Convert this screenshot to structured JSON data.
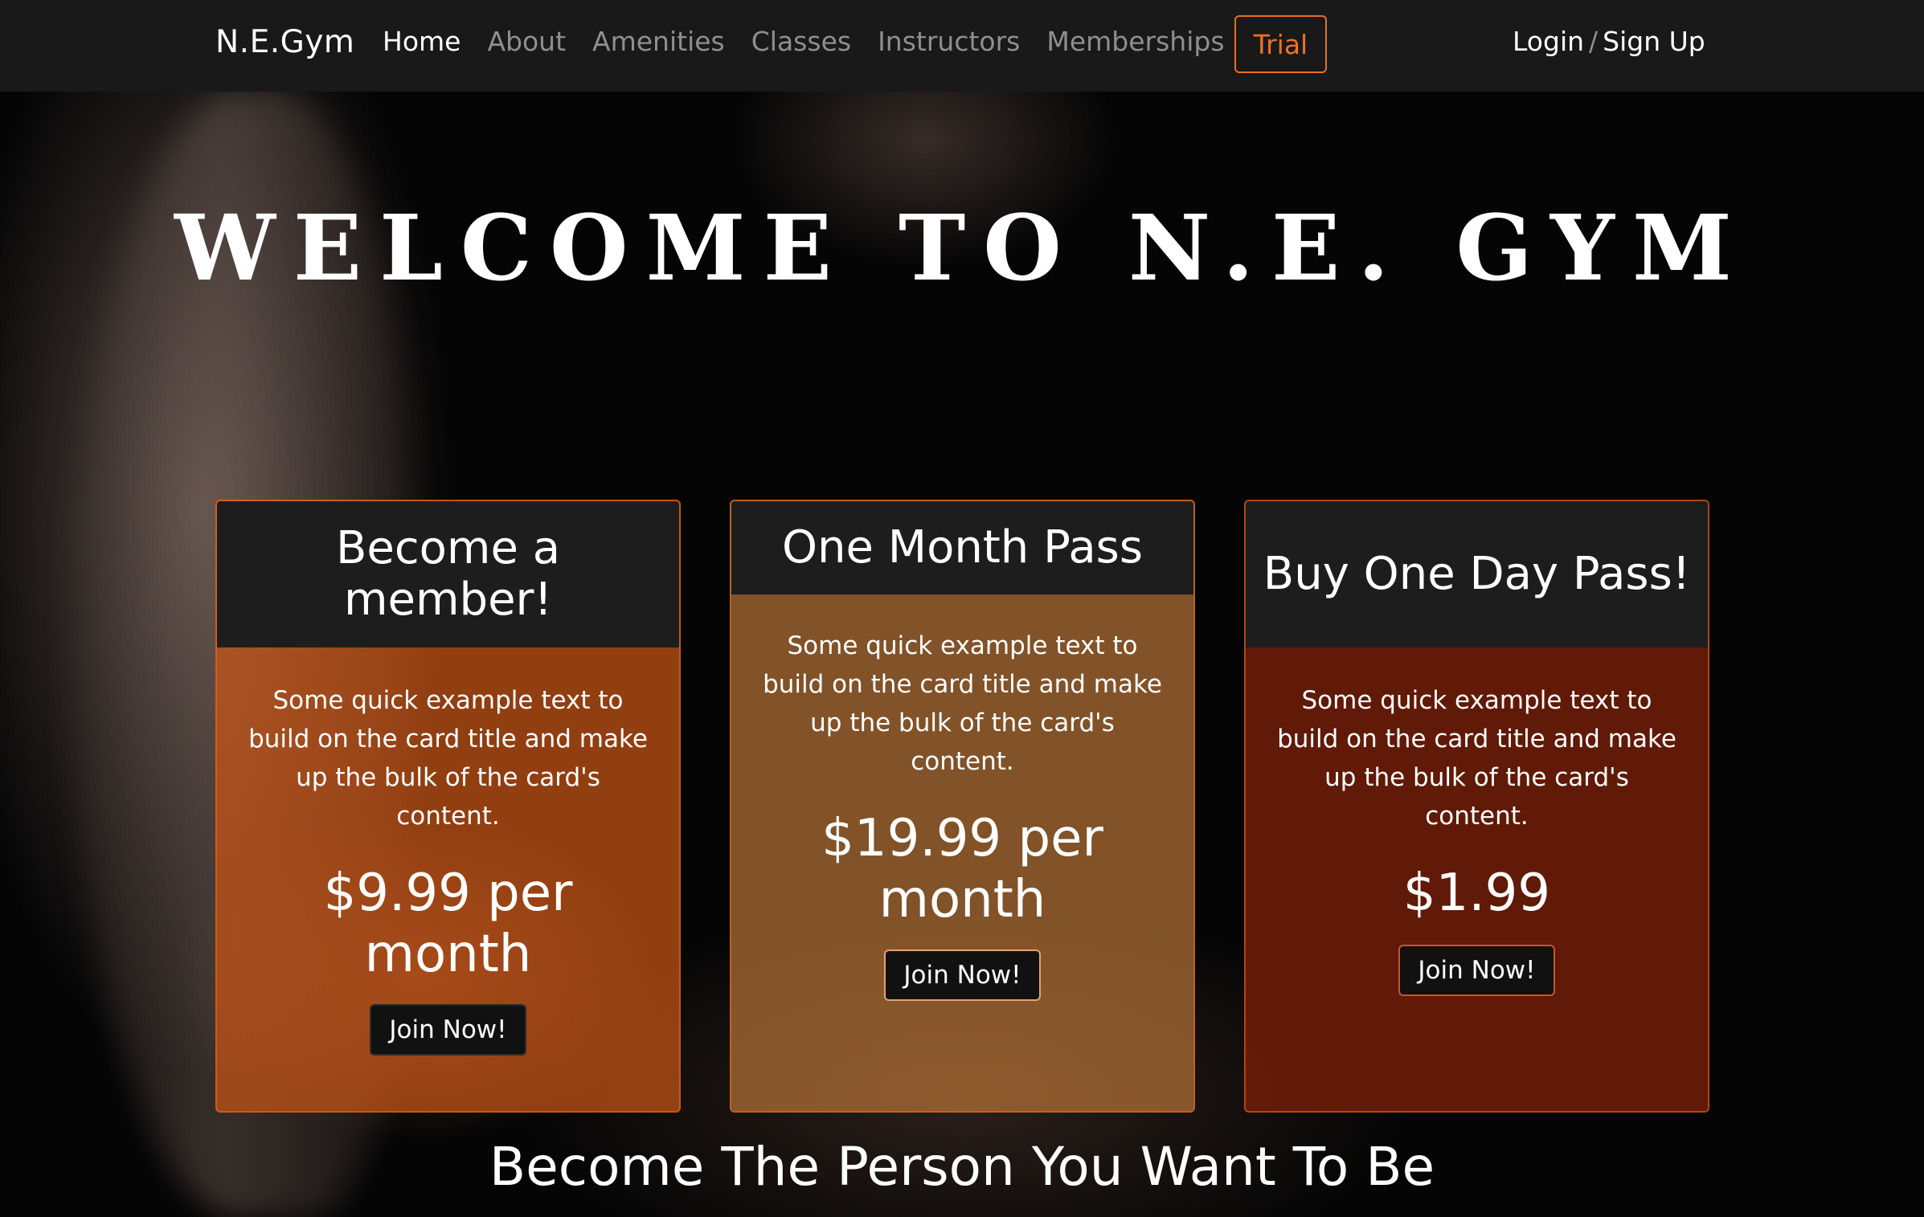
{
  "navbar": {
    "brand": "N.E.Gym",
    "links": [
      "Home",
      "About",
      "Amenities",
      "Classes",
      "Instructors",
      "Memberships"
    ],
    "trial_label": "Trial",
    "login_label": "Login",
    "separator": "/",
    "signup_label": "Sign Up"
  },
  "hero": {
    "title": "WELCOME TO N.E. GYM",
    "tagline": "Become The Person You Want To Be"
  },
  "cards": [
    {
      "title": "Become a member!",
      "text": "Some quick example text to build on the card title and make up the bulk of the card's content.",
      "price": "$9.99 per month",
      "button": "Join Now!"
    },
    {
      "title": "One Month Pass",
      "text": "Some quick example text to build on the card title and make up the bulk of the card's content.",
      "price": "$19.99 per month",
      "button": "Join Now!"
    },
    {
      "title": "Buy One Day Pass!",
      "text": "Some quick example text to build on the card title and make up the bulk of the card's content.",
      "price": "$1.99",
      "button": "Join Now!"
    }
  ],
  "colors": {
    "accent": "#ec7324",
    "navbar_bg": "#191919",
    "card1_bg": "#c75416",
    "card2_bg": "#b87438",
    "card3_bg": "#7a2008"
  }
}
